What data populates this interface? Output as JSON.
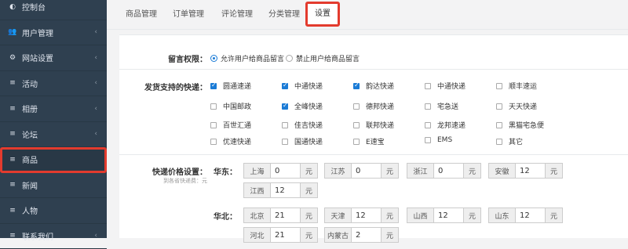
{
  "sidebar": {
    "items": [
      {
        "icon": "dashboard-icon",
        "glyph": "◐",
        "label": "控制台",
        "chevron": ""
      },
      {
        "icon": "users-icon",
        "glyph": "👥",
        "label": "用户管理",
        "chevron": "‹"
      },
      {
        "icon": "gears-icon",
        "glyph": "⚙",
        "label": "网站设置",
        "chevron": "‹"
      },
      {
        "icon": "list-icon",
        "glyph": "≡",
        "label": "活动",
        "chevron": "‹"
      },
      {
        "icon": "list-icon",
        "glyph": "≡",
        "label": "相册",
        "chevron": "‹"
      },
      {
        "icon": "list-icon",
        "glyph": "≡",
        "label": "论坛",
        "chevron": "‹"
      },
      {
        "icon": "list-icon",
        "glyph": "≡",
        "label": "商品",
        "chevron": ""
      },
      {
        "icon": "list-icon",
        "glyph": "≡",
        "label": "新闻",
        "chevron": ""
      },
      {
        "icon": "list-icon",
        "glyph": "≡",
        "label": "人物",
        "chevron": ""
      },
      {
        "icon": "list-icon",
        "glyph": "≡",
        "label": "联系我们",
        "chevron": "‹"
      }
    ],
    "active_index": 6
  },
  "tabs": [
    "商品管理",
    "订单管理",
    "评论管理",
    "分类管理",
    "设置"
  ],
  "active_tab": 4,
  "comment_permission": {
    "label": "留言权限：",
    "options": [
      {
        "label": "允许用户给商品留言",
        "checked": true
      },
      {
        "label": "禁止用户给商品留言",
        "checked": false
      }
    ]
  },
  "express": {
    "label": "发货支持的快递：",
    "items": [
      {
        "label": "圆通速递",
        "checked": true
      },
      {
        "label": "中通快递",
        "checked": true
      },
      {
        "label": "韵达快递",
        "checked": true
      },
      {
        "label": "中通快递",
        "checked": false
      },
      {
        "label": "顺丰速运",
        "checked": false
      },
      {
        "label": "中国邮政",
        "checked": false
      },
      {
        "label": "全峰快递",
        "checked": true
      },
      {
        "label": "德邦快递",
        "checked": false
      },
      {
        "label": "宅急送",
        "checked": false
      },
      {
        "label": "天天快递",
        "checked": false
      },
      {
        "label": "百世汇通",
        "checked": false
      },
      {
        "label": "佳吉快递",
        "checked": false
      },
      {
        "label": "联邦快递",
        "checked": false
      },
      {
        "label": "龙邦速递",
        "checked": false
      },
      {
        "label": "黑猫宅急便",
        "checked": false
      },
      {
        "label": "优速快递",
        "checked": false
      },
      {
        "label": "国通快递",
        "checked": false
      },
      {
        "label": "E速宝",
        "checked": false
      },
      {
        "label": "EMS",
        "checked": false
      },
      {
        "label": "其它",
        "checked": false
      }
    ]
  },
  "prices": {
    "label": "快递价格设置：",
    "sublabel": "到各省快递费：元",
    "unit": "元",
    "regions": [
      {
        "name": "华东：",
        "provinces": [
          {
            "name": "上海",
            "value": "0"
          },
          {
            "name": "江苏",
            "value": "0"
          },
          {
            "name": "浙江",
            "value": "0"
          },
          {
            "name": "安徽",
            "value": "12"
          },
          {
            "name": "江西",
            "value": "12"
          }
        ]
      },
      {
        "name": "华北：",
        "provinces": [
          {
            "name": "北京",
            "value": "21"
          },
          {
            "name": "天津",
            "value": "12"
          },
          {
            "name": "山西",
            "value": "12"
          },
          {
            "name": "山东",
            "value": "12"
          },
          {
            "name": "河北",
            "value": "21"
          },
          {
            "name": "内蒙古",
            "value": "2"
          }
        ]
      }
    ]
  }
}
